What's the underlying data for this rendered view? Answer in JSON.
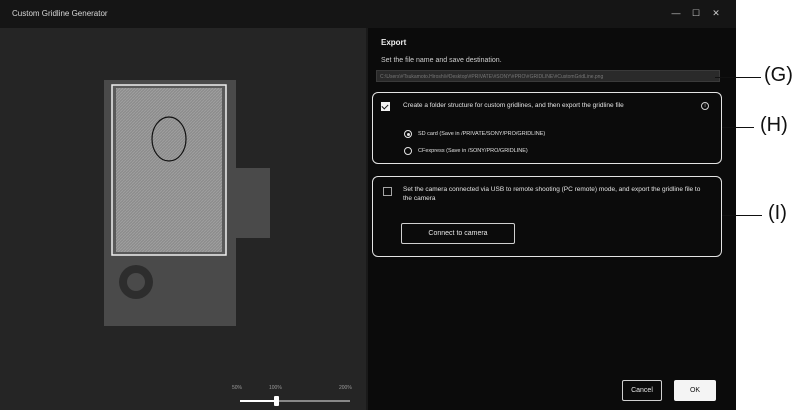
{
  "window": {
    "title": "Custom Gridline Generator",
    "controls": [
      "—",
      "☐",
      "✕"
    ]
  },
  "preview": {
    "zoom": {
      "labels": [
        "50%",
        "100%",
        "200%"
      ],
      "level": 100
    }
  },
  "export": {
    "heading": "Export",
    "instruction": "Set the file name and save destination.",
    "path": "C:\\Users\\#Tsukamoto.Hiroshi\\#Desktop\\#PRIVATE\\#SONY\\#PRO\\#GRIDLINE\\#CustomGridLine.png",
    "folder_option": {
      "checked": true,
      "label": "Create a folder structure for custom gridlines, and then export the gridline file",
      "radios": [
        {
          "label": "SD card (Save in /PRIVATE/SONY/PRO/GRIDLINE)",
          "selected": true
        },
        {
          "label": "CFexpress (Save in /SONY/PRO/GRIDLINE)",
          "selected": false
        }
      ]
    },
    "camera_option": {
      "checked": false,
      "label": "Set the camera connected via USB to remote shooting (PC remote) mode, and export the gridline file to the camera",
      "button": "Connect to camera"
    },
    "cancel": "Cancel",
    "ok": "OK"
  },
  "callouts": [
    "(G)",
    "(H)",
    "(I)"
  ]
}
